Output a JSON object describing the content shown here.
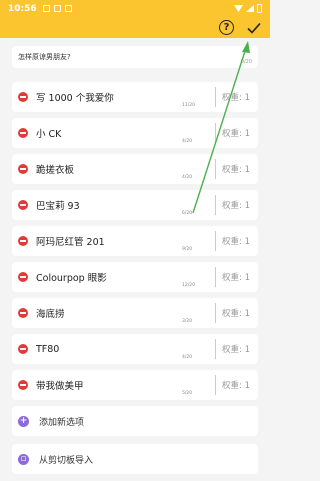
{
  "status_bar": {
    "time": "10:56"
  },
  "toolbar": {
    "help_icon": "question-circle-icon",
    "confirm_icon": "check-icon",
    "help_glyph": "?"
  },
  "title_card": {
    "placeholder": "怎样原谅男朋友?",
    "counter": "0/20"
  },
  "options": [
    {
      "text": "写 1000 个我爱你",
      "count": "11/20",
      "weight_label": "权重: 1"
    },
    {
      "text": "小 CK",
      "count": "4/20",
      "weight_label": "权重: 1"
    },
    {
      "text": "跪搓衣板",
      "count": "4/20",
      "weight_label": "权重: 1"
    },
    {
      "text": "巴宝莉 93",
      "count": "6/20",
      "weight_label": "权重: 1"
    },
    {
      "text": "阿玛尼红管 201",
      "count": "9/20",
      "weight_label": "权重: 1"
    },
    {
      "text": "Colourpop 眼影",
      "count": "12/20",
      "weight_label": "权重: 1"
    },
    {
      "text": "海底捞",
      "count": "3/20",
      "weight_label": "权重: 1"
    },
    {
      "text": "TF80",
      "count": "4/20",
      "weight_label": "权重: 1"
    },
    {
      "text": "带我做美甲",
      "count": "5/20",
      "weight_label": "权重: 1"
    }
  ],
  "actions": {
    "add_option": "添加新选项",
    "import_clipboard": "从剪切板导入"
  },
  "colors": {
    "accent": "#fbc530",
    "delete": "#e53935",
    "purple": "#8c6ad8",
    "arrow": "#4caf50"
  }
}
